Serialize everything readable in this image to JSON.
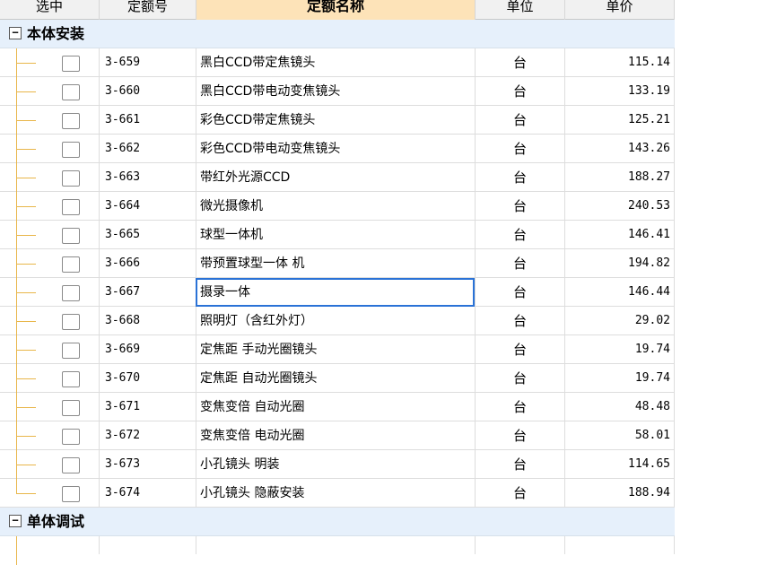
{
  "headers": {
    "select": "选中",
    "code": "定额号",
    "name": "定额名称",
    "unit": "单位",
    "price": "单价"
  },
  "groups": [
    {
      "toggle": "−",
      "title": "本体安装",
      "rows": [
        {
          "code": "3-659",
          "name": "黑白CCD带定焦镜头",
          "unit": "台",
          "price": "115.14",
          "checked": false
        },
        {
          "code": "3-660",
          "name": "黑白CCD带电动变焦镜头",
          "unit": "台",
          "price": "133.19",
          "checked": false
        },
        {
          "code": "3-661",
          "name": "彩色CCD带定焦镜头",
          "unit": "台",
          "price": "125.21",
          "checked": false
        },
        {
          "code": "3-662",
          "name": "彩色CCD带电动变焦镜头",
          "unit": "台",
          "price": "143.26",
          "checked": false
        },
        {
          "code": "3-663",
          "name": "带红外光源CCD",
          "unit": "台",
          "price": "188.27",
          "checked": false
        },
        {
          "code": "3-664",
          "name": "微光摄像机",
          "unit": "台",
          "price": "240.53",
          "checked": false
        },
        {
          "code": "3-665",
          "name": "球型一体机",
          "unit": "台",
          "price": "146.41",
          "checked": false
        },
        {
          "code": "3-666",
          "name": "带预置球型一体 机",
          "unit": "台",
          "price": "194.82",
          "checked": false
        },
        {
          "code": "3-667",
          "name": "摄录一体",
          "unit": "台",
          "price": "146.44",
          "checked": false,
          "focused": true
        },
        {
          "code": "3-668",
          "name": "照明灯（含红外灯）",
          "unit": "台",
          "price": "29.02",
          "checked": false
        },
        {
          "code": "3-669",
          "name": "定焦距 手动光圈镜头",
          "unit": "台",
          "price": "19.74",
          "checked": false
        },
        {
          "code": "3-670",
          "name": "定焦距 自动光圈镜头",
          "unit": "台",
          "price": "19.74",
          "checked": false
        },
        {
          "code": "3-671",
          "name": "变焦变倍 自动光圈",
          "unit": "台",
          "price": "48.48",
          "checked": false
        },
        {
          "code": "3-672",
          "name": "变焦变倍 电动光圈",
          "unit": "台",
          "price": "58.01",
          "checked": false
        },
        {
          "code": "3-673",
          "name": "小孔镜头 明装",
          "unit": "台",
          "price": "114.65",
          "checked": false
        },
        {
          "code": "3-674",
          "name": "小孔镜头 隐蔽安装",
          "unit": "台",
          "price": "188.94",
          "checked": false
        }
      ]
    },
    {
      "toggle": "−",
      "title": "单体调试",
      "rows": []
    }
  ],
  "colors": {
    "header_bg": "#f1f1f1",
    "header_active_bg": "#fde3b8",
    "group_bg": "#e6f0fb",
    "tree_line": "#e8b64a",
    "focus_border": "#2a72d6"
  }
}
